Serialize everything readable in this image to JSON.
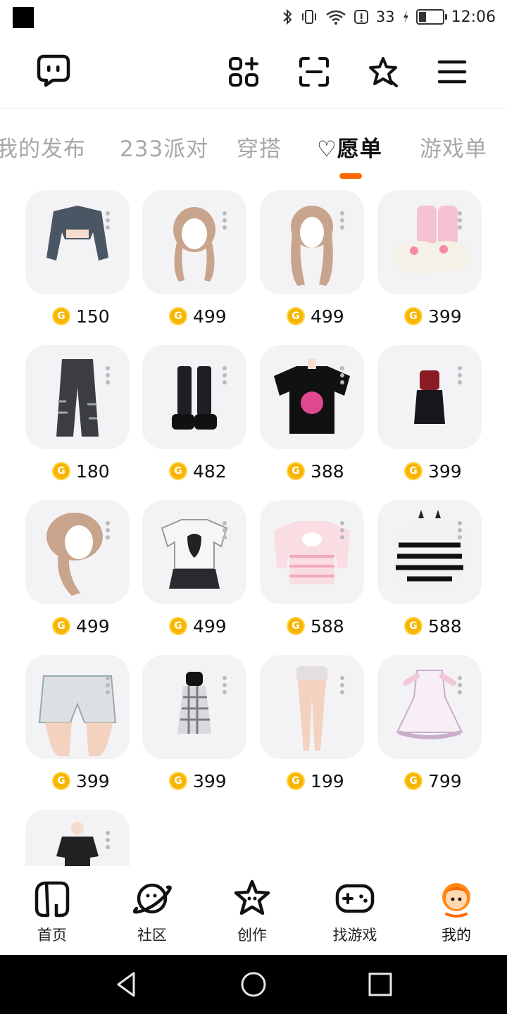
{
  "status": {
    "battery": "33",
    "battery_level": 0.33,
    "time": "12:06"
  },
  "top_bar": {
    "icons": [
      "chat-bubble-icon",
      "apps-add-icon",
      "scan-icon",
      "star-icon",
      "menu-icon"
    ]
  },
  "tabs": [
    {
      "label": "我的发布",
      "active": false
    },
    {
      "label": "233派对",
      "active": false
    },
    {
      "label": "穿搭",
      "active": false
    },
    {
      "label": "♡愿单",
      "active": true
    },
    {
      "label": "游戏单",
      "active": false
    }
  ],
  "items": [
    {
      "name": "jacket",
      "price": "150"
    },
    {
      "name": "twin-tail-hair",
      "price": "499"
    },
    {
      "name": "long-hair",
      "price": "499"
    },
    {
      "name": "bunny-slippers",
      "price": "399"
    },
    {
      "name": "ripped-jeans",
      "price": "180"
    },
    {
      "name": "platform-boots",
      "price": "482"
    },
    {
      "name": "black-tee",
      "price": "388"
    },
    {
      "name": "red-black-outfit",
      "price": "399"
    },
    {
      "name": "braided-hair",
      "price": "499"
    },
    {
      "name": "white-tee-skirt",
      "price": "499"
    },
    {
      "name": "pink-sweater",
      "price": "588"
    },
    {
      "name": "striped-sweater",
      "price": "588"
    },
    {
      "name": "denim-shorts",
      "price": "399"
    },
    {
      "name": "plaid-dress",
      "price": "399"
    },
    {
      "name": "bare-legs",
      "price": "199"
    },
    {
      "name": "lace-dress",
      "price": "799"
    },
    {
      "name": "black-set",
      "price": ""
    }
  ],
  "coin_symbol": "G",
  "bottom_nav": [
    {
      "label": "首页",
      "icon": "home-icon",
      "active": false
    },
    {
      "label": "社区",
      "icon": "planet-icon",
      "active": false
    },
    {
      "label": "创作",
      "icon": "star-create-icon",
      "active": false
    },
    {
      "label": "找游戏",
      "icon": "gamepad-icon",
      "active": false
    },
    {
      "label": "我的",
      "icon": "profile-face-icon",
      "active": true
    }
  ],
  "colors": {
    "accent": "#ff6a00",
    "coin": "#f7b500",
    "thumb_bg": "#f3f3f6"
  }
}
